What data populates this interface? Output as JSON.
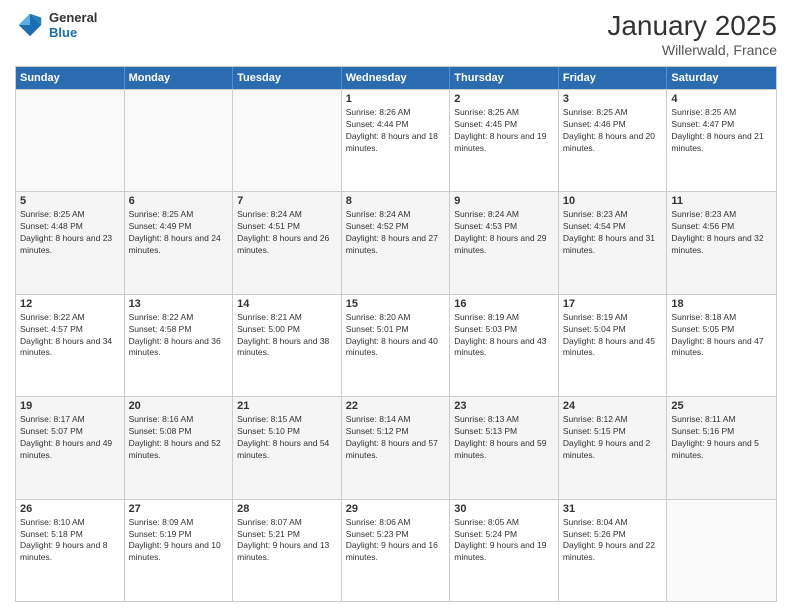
{
  "header": {
    "logo_general": "General",
    "logo_blue": "Blue",
    "title": "January 2025",
    "subtitle": "Willerwald, France"
  },
  "calendar": {
    "days_of_week": [
      "Sunday",
      "Monday",
      "Tuesday",
      "Wednesday",
      "Thursday",
      "Friday",
      "Saturday"
    ],
    "weeks": [
      [
        {
          "day": "",
          "empty": true
        },
        {
          "day": "",
          "empty": true
        },
        {
          "day": "",
          "empty": true
        },
        {
          "day": "1",
          "sunrise": "8:26 AM",
          "sunset": "4:44 PM",
          "daylight": "8 hours and 18 minutes."
        },
        {
          "day": "2",
          "sunrise": "8:25 AM",
          "sunset": "4:45 PM",
          "daylight": "8 hours and 19 minutes."
        },
        {
          "day": "3",
          "sunrise": "8:25 AM",
          "sunset": "4:46 PM",
          "daylight": "8 hours and 20 minutes."
        },
        {
          "day": "4",
          "sunrise": "8:25 AM",
          "sunset": "4:47 PM",
          "daylight": "8 hours and 21 minutes."
        }
      ],
      [
        {
          "day": "5",
          "sunrise": "8:25 AM",
          "sunset": "4:48 PM",
          "daylight": "8 hours and 23 minutes."
        },
        {
          "day": "6",
          "sunrise": "8:25 AM",
          "sunset": "4:49 PM",
          "daylight": "8 hours and 24 minutes."
        },
        {
          "day": "7",
          "sunrise": "8:24 AM",
          "sunset": "4:51 PM",
          "daylight": "8 hours and 26 minutes."
        },
        {
          "day": "8",
          "sunrise": "8:24 AM",
          "sunset": "4:52 PM",
          "daylight": "8 hours and 27 minutes."
        },
        {
          "day": "9",
          "sunrise": "8:24 AM",
          "sunset": "4:53 PM",
          "daylight": "8 hours and 29 minutes."
        },
        {
          "day": "10",
          "sunrise": "8:23 AM",
          "sunset": "4:54 PM",
          "daylight": "8 hours and 31 minutes."
        },
        {
          "day": "11",
          "sunrise": "8:23 AM",
          "sunset": "4:56 PM",
          "daylight": "8 hours and 32 minutes."
        }
      ],
      [
        {
          "day": "12",
          "sunrise": "8:22 AM",
          "sunset": "4:57 PM",
          "daylight": "8 hours and 34 minutes."
        },
        {
          "day": "13",
          "sunrise": "8:22 AM",
          "sunset": "4:58 PM",
          "daylight": "8 hours and 36 minutes."
        },
        {
          "day": "14",
          "sunrise": "8:21 AM",
          "sunset": "5:00 PM",
          "daylight": "8 hours and 38 minutes."
        },
        {
          "day": "15",
          "sunrise": "8:20 AM",
          "sunset": "5:01 PM",
          "daylight": "8 hours and 40 minutes."
        },
        {
          "day": "16",
          "sunrise": "8:19 AM",
          "sunset": "5:03 PM",
          "daylight": "8 hours and 43 minutes."
        },
        {
          "day": "17",
          "sunrise": "8:19 AM",
          "sunset": "5:04 PM",
          "daylight": "8 hours and 45 minutes."
        },
        {
          "day": "18",
          "sunrise": "8:18 AM",
          "sunset": "5:05 PM",
          "daylight": "8 hours and 47 minutes."
        }
      ],
      [
        {
          "day": "19",
          "sunrise": "8:17 AM",
          "sunset": "5:07 PM",
          "daylight": "8 hours and 49 minutes."
        },
        {
          "day": "20",
          "sunrise": "8:16 AM",
          "sunset": "5:08 PM",
          "daylight": "8 hours and 52 minutes."
        },
        {
          "day": "21",
          "sunrise": "8:15 AM",
          "sunset": "5:10 PM",
          "daylight": "8 hours and 54 minutes."
        },
        {
          "day": "22",
          "sunrise": "8:14 AM",
          "sunset": "5:12 PM",
          "daylight": "8 hours and 57 minutes."
        },
        {
          "day": "23",
          "sunrise": "8:13 AM",
          "sunset": "5:13 PM",
          "daylight": "8 hours and 59 minutes."
        },
        {
          "day": "24",
          "sunrise": "8:12 AM",
          "sunset": "5:15 PM",
          "daylight": "9 hours and 2 minutes."
        },
        {
          "day": "25",
          "sunrise": "8:11 AM",
          "sunset": "5:16 PM",
          "daylight": "9 hours and 5 minutes."
        }
      ],
      [
        {
          "day": "26",
          "sunrise": "8:10 AM",
          "sunset": "5:18 PM",
          "daylight": "9 hours and 8 minutes."
        },
        {
          "day": "27",
          "sunrise": "8:09 AM",
          "sunset": "5:19 PM",
          "daylight": "9 hours and 10 minutes."
        },
        {
          "day": "28",
          "sunrise": "8:07 AM",
          "sunset": "5:21 PM",
          "daylight": "9 hours and 13 minutes."
        },
        {
          "day": "29",
          "sunrise": "8:06 AM",
          "sunset": "5:23 PM",
          "daylight": "9 hours and 16 minutes."
        },
        {
          "day": "30",
          "sunrise": "8:05 AM",
          "sunset": "5:24 PM",
          "daylight": "9 hours and 19 minutes."
        },
        {
          "day": "31",
          "sunrise": "8:04 AM",
          "sunset": "5:26 PM",
          "daylight": "9 hours and 22 minutes."
        },
        {
          "day": "",
          "empty": true
        }
      ]
    ]
  }
}
